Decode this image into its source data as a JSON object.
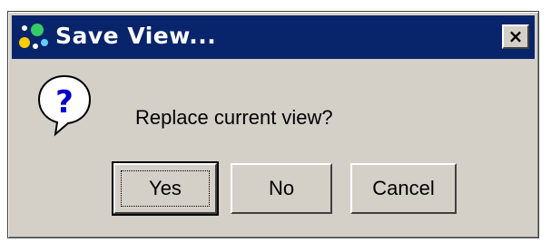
{
  "window": {
    "title": "Save View...",
    "close_label": "×"
  },
  "message": {
    "icon": "question-icon",
    "text": "Replace current view?"
  },
  "buttons": {
    "yes_label": "Yes",
    "no_label": "No",
    "cancel_label": "Cancel"
  },
  "colors": {
    "titlebar": "#08246b",
    "dialog_face": "#d4d0c8"
  }
}
